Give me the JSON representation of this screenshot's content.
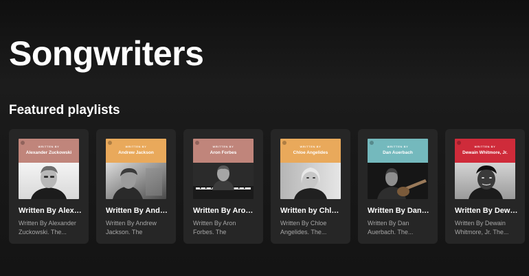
{
  "page": {
    "title": "Songwriters",
    "section_title": "Featured playlists"
  },
  "playlists": [
    {
      "cover_label": "WRITTEN BY",
      "cover_name": "Alexander Zuckowski",
      "cover_color": "#c0857b",
      "title": "Written By Alexander Zuckowski",
      "description": "Written By Alexander Zuckowski. The..."
    },
    {
      "cover_label": "WRITTEN BY",
      "cover_name": "Andrew Jackson",
      "cover_color": "#e9a95b",
      "title": "Written By Andrew Jackson",
      "description": "Written By Andrew Jackson. The essenti..."
    },
    {
      "cover_label": "WRITTEN BY",
      "cover_name": "Aron Forbes",
      "cover_color": "#c0857b",
      "title": "Written By Aron Forbes",
      "description": "Written By Aron Forbes. The essentia..."
    },
    {
      "cover_label": "WRITTEN BY",
      "cover_name": "Chloe Angelides",
      "cover_color": "#e9a95b",
      "title": "Written by Chloe Angelides",
      "description": "Written By Chloe Angelides. The..."
    },
    {
      "cover_label": "WRITTEN BY",
      "cover_name": "Dan Auerbach",
      "cover_color": "#74b9bd",
      "title": "Written By Dan Auerbach",
      "description": "Written By Dan Auerbach. The..."
    },
    {
      "cover_label": "WRITTEN BY",
      "cover_name": "Dewain Whitmore, Jr.",
      "cover_color": "#cf2b3a",
      "title": "Written By Dewain Whitmore, Jr.",
      "description": "Written By Dewain Whitmore, Jr. The..."
    }
  ]
}
